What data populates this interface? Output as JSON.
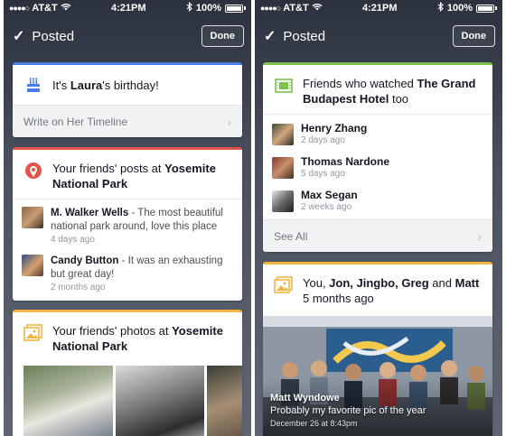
{
  "status": {
    "carrier": "AT&T",
    "time": "4:21PM",
    "battery": "100%"
  },
  "topbar": {
    "title": "Posted",
    "done_label": "Done"
  },
  "left": {
    "birthday": {
      "prefix": "It's ",
      "name": "Laura",
      "suffix": "'s birthday!",
      "action": "Write on Her Timeline",
      "accent": "#4a7ce8"
    },
    "posts_card": {
      "prefix": "Your friends' posts at ",
      "place": "Yosemite National Park",
      "accent": "#e5534b",
      "posts": [
        {
          "author": "M. Walker Wells",
          "text": "The most beautiful national park around, love this place",
          "time": "4 days ago"
        },
        {
          "author": "Candy Button",
          "text": "It was an exhausting but great day!",
          "time": "2 months ago"
        }
      ]
    },
    "photos_card": {
      "prefix": "Your friends' photos at ",
      "place": "Yosemite National Park",
      "accent": "#f2b544"
    }
  },
  "right": {
    "movie_card": {
      "prefix": "Friends who watched ",
      "title": "The Grand Budapest Hotel",
      "suffix": " too",
      "accent": "#7cc34a",
      "friends": [
        {
          "name": "Henry Zhang",
          "time": "2 days ago"
        },
        {
          "name": "Thomas Nardone",
          "time": "5 days ago"
        },
        {
          "name": "Max Segan",
          "time": "2 weeks ago"
        }
      ],
      "see_all": "See All"
    },
    "memory_card": {
      "prefix": "You, ",
      "names": "Jon, Jingbo, Greg",
      "and": " and ",
      "last": "Matt",
      "time": "5 months ago",
      "accent": "#f2b544",
      "caption_author": "Matt Wyndowe",
      "caption_text": "Probably my favorite pic of the year",
      "caption_date": "December 26 at 8:43pm"
    }
  }
}
